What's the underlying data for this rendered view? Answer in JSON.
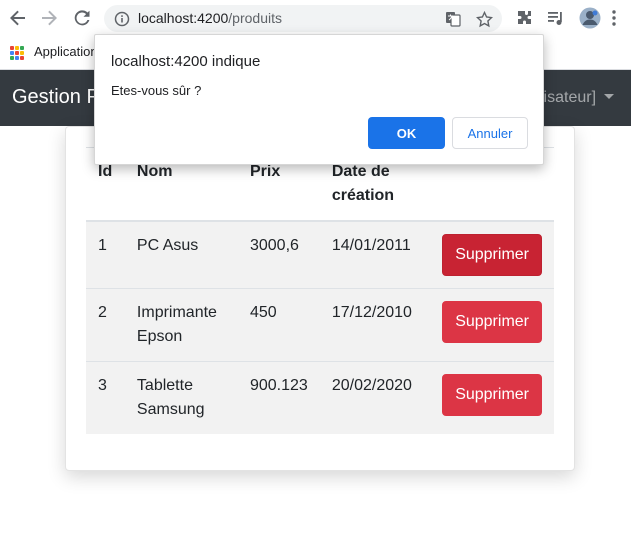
{
  "browser": {
    "url_host": "localhost:4200",
    "url_path": "/produits",
    "bookmarks_label": "Applications"
  },
  "navbar": {
    "brand": "Gestion P",
    "user_menu": "lisateur]"
  },
  "table": {
    "headers": {
      "id": "Id",
      "nom": "Nom",
      "prix": "Prix",
      "date_line1": "Date de",
      "date_line2": "création"
    },
    "rows": [
      {
        "id": "1",
        "nom": "PC Asus",
        "prix": "3000,6",
        "date": "14/01/2011",
        "action": "Supprimer"
      },
      {
        "id": "2",
        "nom": "Imprimante Epson",
        "prix": "450",
        "date": "17/12/2010",
        "action": "Supprimer"
      },
      {
        "id": "3",
        "nom": "Tablette Samsung",
        "prix": "900.123",
        "date": "20/02/2020",
        "action": "Supprimer"
      }
    ]
  },
  "dialog": {
    "title": "localhost:4200 indique",
    "message": "Etes-vous sûr ?",
    "ok_label": "OK",
    "cancel_label": "Annuler"
  },
  "colors": {
    "navbar": "#343a40",
    "danger": "#dc3545",
    "danger_active": "#c82333",
    "dialog_primary": "#1a73e8"
  }
}
